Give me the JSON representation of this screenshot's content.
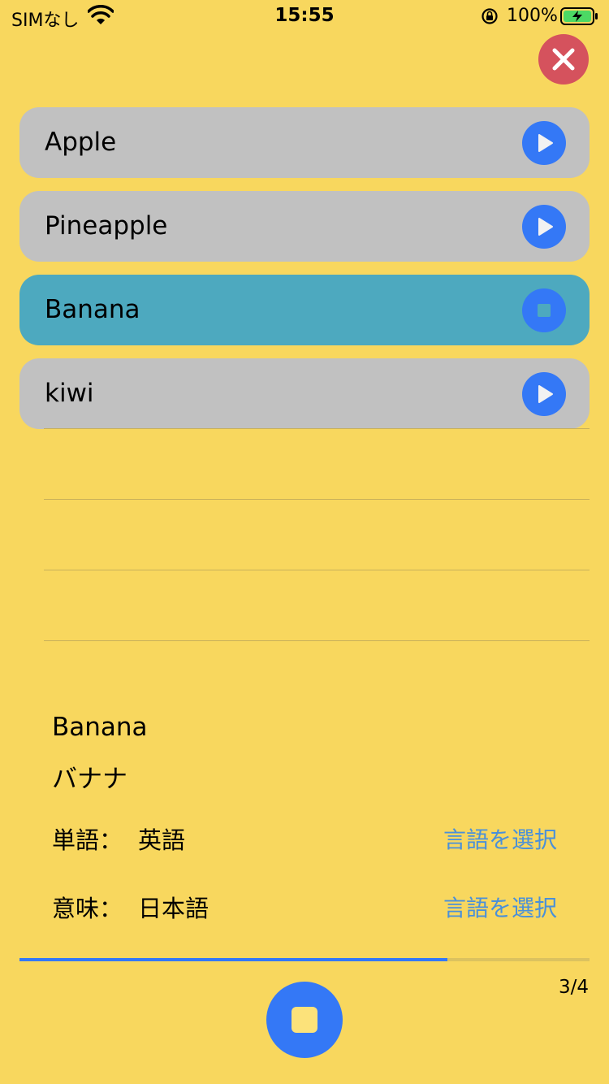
{
  "status_bar": {
    "carrier": "SIMなし",
    "time": "15:55",
    "battery_percent": "100%",
    "icons": [
      "wifi-icon",
      "orientation-lock-icon",
      "battery-charging-icon"
    ]
  },
  "close_button": {
    "icon": "close-icon",
    "color": "#D5525D"
  },
  "word_list": [
    {
      "label": "Apple",
      "state": "idle",
      "icon": "play-icon"
    },
    {
      "label": "Pineapple",
      "state": "idle",
      "icon": "play-icon"
    },
    {
      "label": "Banana",
      "state": "playing",
      "icon": "stop-icon"
    },
    {
      "label": "kiwi",
      "state": "idle",
      "icon": "play-icon"
    }
  ],
  "detail": {
    "word": "Banana",
    "meaning": "バナナ",
    "word_language": {
      "label": "単語：",
      "value": "英語",
      "action": "言語を選択"
    },
    "meaning_language": {
      "label": "意味：",
      "value": "日本語",
      "action": "言語を選択"
    }
  },
  "progress": {
    "current": 3,
    "total": 4,
    "text": "3/4",
    "fraction": 0.75
  },
  "main_button": {
    "icon": "stop-icon"
  },
  "colors": {
    "background": "#F8D75E",
    "row_idle": "#C1C1C1",
    "row_active": "#4DA9BF",
    "accent": "#3478F6",
    "link": "#4A90D9"
  }
}
